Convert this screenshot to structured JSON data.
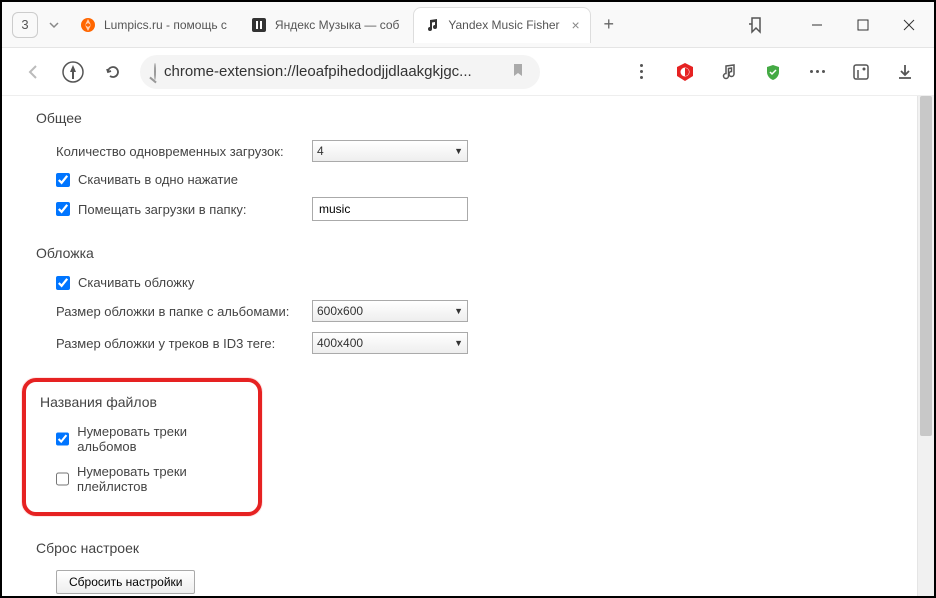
{
  "titlebar": {
    "tab_count": "3",
    "tabs": [
      {
        "title": "Lumpics.ru - помощь с",
        "active": false
      },
      {
        "title": "Яндекс Музыка — соб",
        "active": false
      },
      {
        "title": "Yandex Music Fisher",
        "active": true
      }
    ]
  },
  "address": {
    "url": "chrome-extension://leoafpihedodjjdlaakgkjgc..."
  },
  "sections": {
    "general": {
      "title": "Общее",
      "concurrent_label": "Количество одновременных загрузок:",
      "concurrent_value": "4",
      "oneclick_label": "Скачивать в одно нажатие",
      "oneclick_checked": true,
      "folder_label": "Помещать загрузки в папку:",
      "folder_checked": true,
      "folder_value": "music"
    },
    "cover": {
      "title": "Обложка",
      "download_label": "Скачивать обложку",
      "download_checked": true,
      "album_size_label": "Размер обложки в папке с альбомами:",
      "album_size_value": "600x600",
      "id3_size_label": "Размер обложки у треков в ID3 теге:",
      "id3_size_value": "400x400"
    },
    "filenames": {
      "title": "Названия файлов",
      "number_albums_label": "Нумеровать треки альбомов",
      "number_albums_checked": true,
      "number_playlists_label": "Нумеровать треки плейлистов",
      "number_playlists_checked": false
    },
    "reset": {
      "title": "Сброс настроек",
      "button": "Сбросить настройки"
    }
  }
}
